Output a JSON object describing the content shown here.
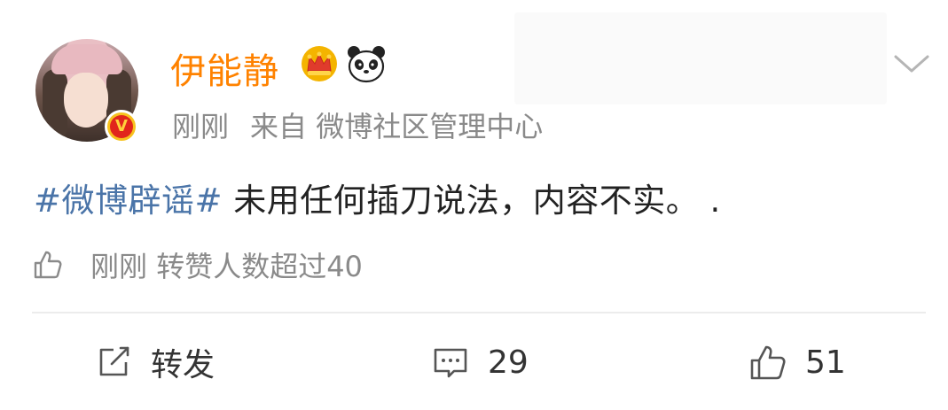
{
  "post": {
    "author": {
      "name": "伊能静",
      "badge_letter": "V"
    },
    "meta": {
      "time": "刚刚",
      "source": "来自 微博社区管理中心"
    },
    "content": {
      "hashtag": "#微博辟谣#",
      "text": " 未用任何插刀说法，内容不实。 ."
    },
    "like_summary": {
      "time": "刚刚",
      "text": "转赞人数超过40"
    },
    "actions": {
      "repost_label": "转发",
      "comment_count": "29",
      "like_count": "51"
    }
  },
  "icons": {
    "crown": "crown-icon",
    "panda": "panda-icon",
    "dropdown": "chevron-down-icon",
    "repost": "share-icon",
    "comment": "comment-icon",
    "like": "thumbs-up-icon"
  },
  "colors": {
    "username": "#ff8200",
    "hashtag": "#4a74a8",
    "secondary_text": "#8a8a8a",
    "badge_red": "#e1261c",
    "badge_gold": "#f7c21e"
  }
}
